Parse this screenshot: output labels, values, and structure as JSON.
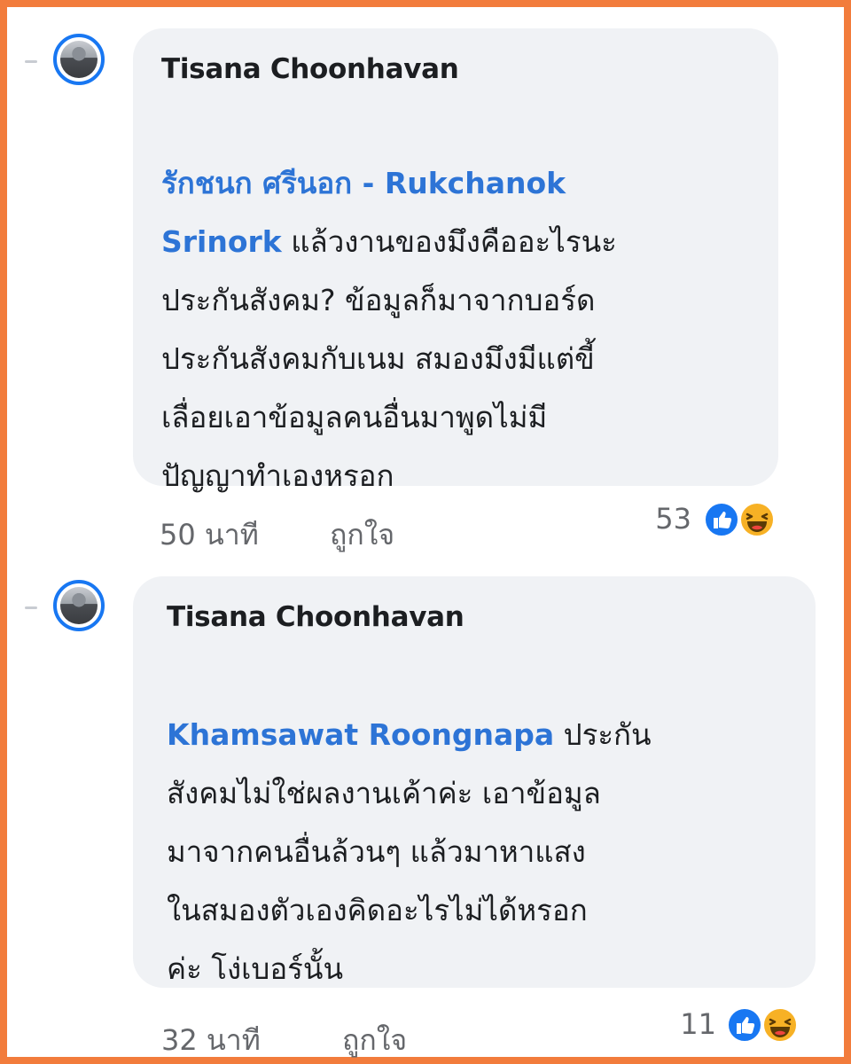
{
  "comments": [
    {
      "author": "Tisana Choonhavan",
      "mention": "รักชนก ศรีนอก - Rukchanok Srinork",
      "mention_line1": "รักชนก ศรีนอก - Rukchanok",
      "mention_line2": "Srinork",
      "text_first": " แล้วงานของมึงคืออะไรนะ",
      "text_rest": "ประกันสังคม? ข้อมูลก็มาจากบอร์ด\nประกันสังคมกับเนม สมองมึงมีแต่ขี้\nเลื่อยเอาข้อมูลคนอื่นมาพูดไม่มี\nปัญญาทำเองหรอก",
      "time": "50 นาที",
      "like_label": "ถูกใจ",
      "reaction_count": "53",
      "reactions": [
        "like-icon",
        "haha-icon"
      ]
    },
    {
      "author": "Tisana Choonhavan",
      "mention": "Khamsawat Roongnapa",
      "text_first": " ประกัน",
      "text_rest": "สังคมไม่ใช่ผลงานเค้าค่ะ เอาข้อมูล\nมาจากคนอื่นล้วนๆ แล้วมาหาแสง\nในสมองตัวเองคิดอะไรไม่ได้หรอก\nค่ะ โง่เบอร์นั้น",
      "time": "32 นาที",
      "like_label": "ถูกใจ",
      "reaction_count": "11",
      "reactions": [
        "like-icon",
        "haha-icon"
      ]
    }
  ],
  "colors": {
    "frame_border": "#f27c3c",
    "bubble_bg": "#f0f2f5",
    "mention": "#2d74d6",
    "like_blue": "#1877f2",
    "haha_yellow": "#f7b125",
    "meta_gray": "#65676b"
  }
}
